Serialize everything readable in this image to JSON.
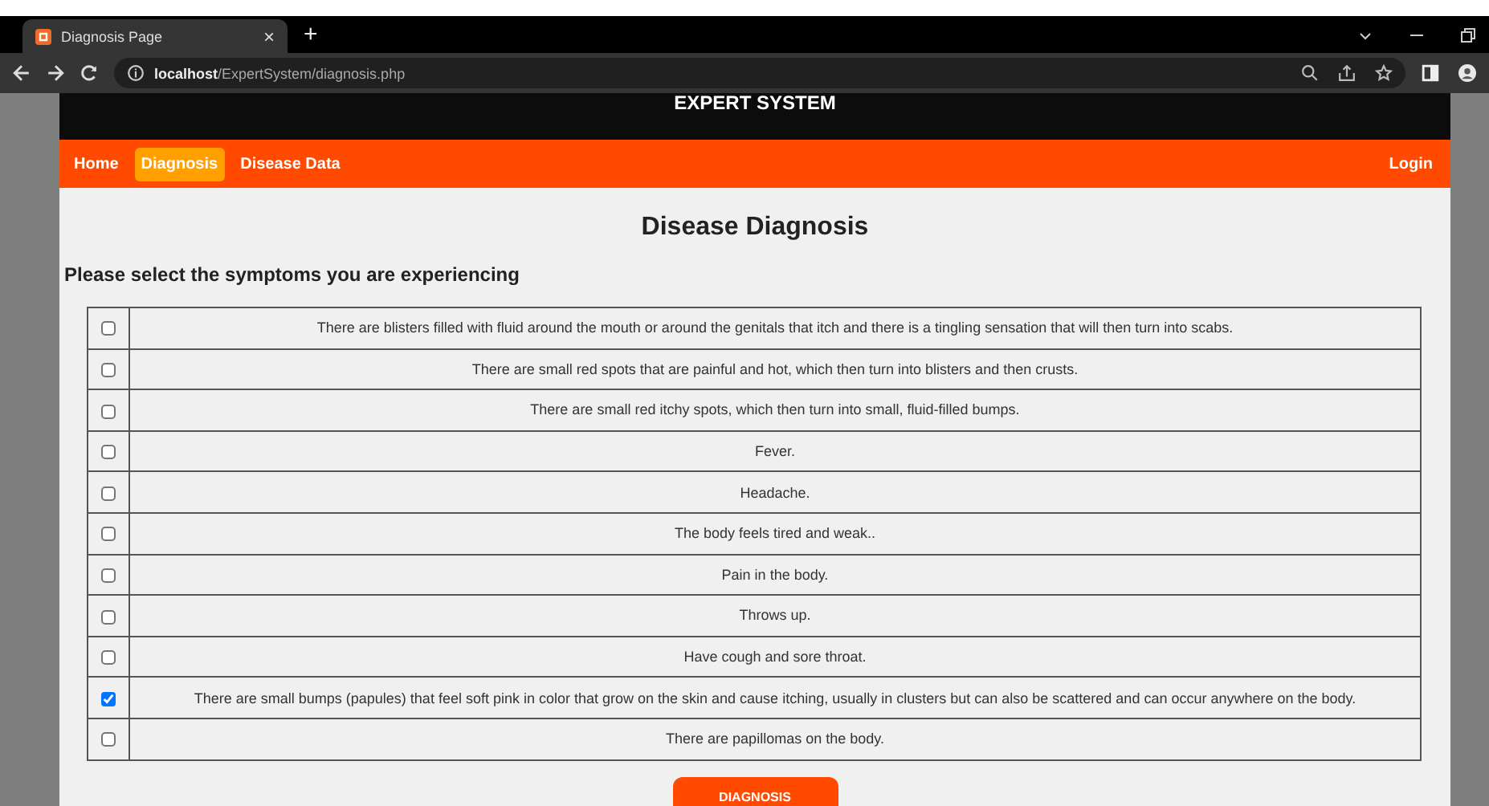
{
  "browser": {
    "tab_title": "Diagnosis Page",
    "tab_close": "×",
    "new_tab": "+",
    "url_host": "localhost",
    "url_path": "/ExpertSystem/diagnosis.php"
  },
  "header": {
    "title": "EXPERT SYSTEM"
  },
  "nav": {
    "items": [
      {
        "label": "Home",
        "selected": false
      },
      {
        "label": "Diagnosis",
        "selected": true
      },
      {
        "label": "Disease Data",
        "selected": false
      }
    ],
    "login": "Login"
  },
  "heading": "Disease Diagnosis",
  "prompt": "Please select the symptoms you are experiencing",
  "symptoms": [
    {
      "text": "There are blisters filled with fluid around the mouth or around the genitals that itch and there is a tingling sensation that will then turn into scabs.",
      "checked": false
    },
    {
      "text": "There are small red spots that are painful and hot, which then turn into blisters and then crusts.",
      "checked": false
    },
    {
      "text": "There are small red itchy spots, which then turn into small, fluid-filled bumps.",
      "checked": false
    },
    {
      "text": "Fever.",
      "checked": false
    },
    {
      "text": "Headache.",
      "checked": false
    },
    {
      "text": "The body feels tired and weak..",
      "checked": false
    },
    {
      "text": "Pain in the body.",
      "checked": false
    },
    {
      "text": "Throws up.",
      "checked": false
    },
    {
      "text": "Have cough and sore throat.",
      "checked": false
    },
    {
      "text": "There are small bumps (papules) that feel soft pink in color that grow on the skin and cause itching, usually in clusters but can also be scattered and can occur anywhere on the body.",
      "checked": true
    },
    {
      "text": "There are papillomas on the body.",
      "checked": false
    }
  ],
  "submit": "DIAGNOSIS"
}
